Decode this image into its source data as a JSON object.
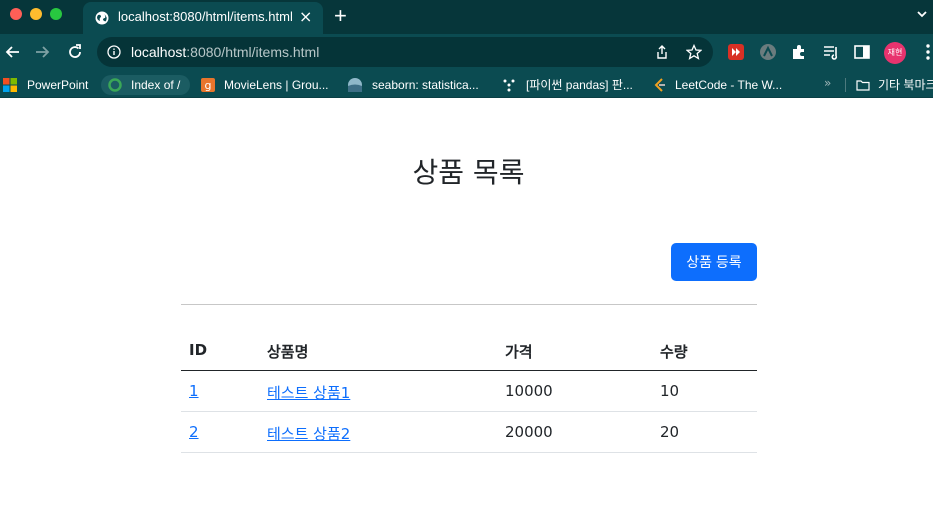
{
  "browser": {
    "tab": {
      "title": "localhost:8080/html/items.html"
    },
    "address": {
      "host": "localhost",
      "path": ":8080/html/items.html"
    },
    "profile_initials": "재현",
    "bookmarks": [
      {
        "label": "PowerPoint",
        "icon": "powerpoint-icon"
      },
      {
        "label": "Index of /",
        "icon": "loading-ring-icon"
      },
      {
        "label": "MovieLens | Grou...",
        "icon": "grouplens-icon"
      },
      {
        "label": "seaborn: statistica...",
        "icon": "seaborn-icon"
      },
      {
        "label": "[파이썬 pandas] 판...",
        "icon": "dots-icon"
      },
      {
        "label": "LeetCode - The W...",
        "icon": "leetcode-icon"
      }
    ],
    "bookmarks_more": "»",
    "other_bookmarks": "기타 북마크"
  },
  "page": {
    "title": "상품 목록",
    "register_button": "상품 등록",
    "table": {
      "headers": [
        "ID",
        "상품명",
        "가격",
        "수량"
      ],
      "rows": [
        {
          "id": "1",
          "name": "테스트 상품1",
          "price": "10000",
          "quantity": "10"
        },
        {
          "id": "2",
          "name": "테스트 상품2",
          "price": "20000",
          "quantity": "20"
        }
      ]
    }
  },
  "colors": {
    "chrome_dark": "#06363a",
    "chrome": "#0b4b51",
    "primary": "#0d6efd",
    "text": "#212529"
  }
}
